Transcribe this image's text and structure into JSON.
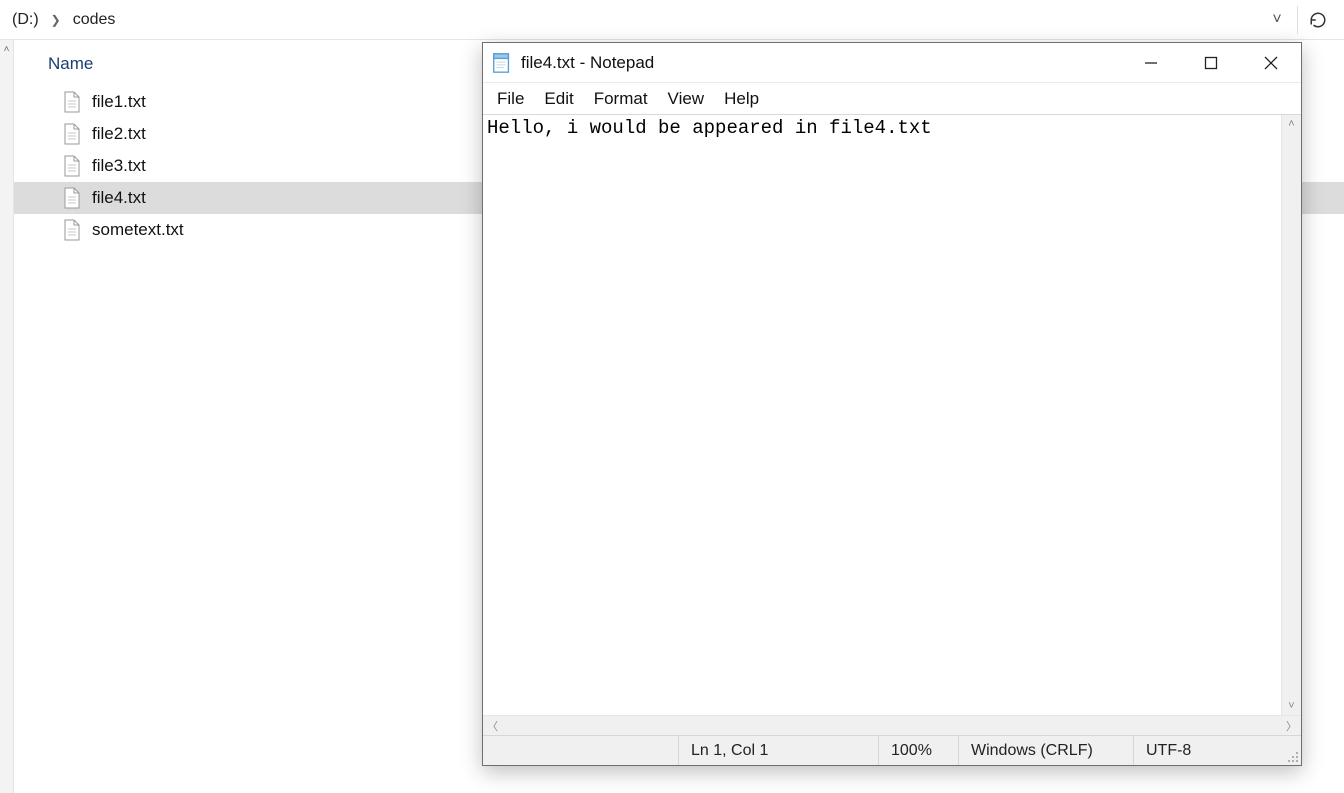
{
  "explorer": {
    "breadcrumb": {
      "drive": "(D:)",
      "folder": "codes"
    },
    "column_header": "Name",
    "files": [
      {
        "name": "file1.txt",
        "selected": false
      },
      {
        "name": "file2.txt",
        "selected": false
      },
      {
        "name": "file3.txt",
        "selected": false
      },
      {
        "name": "file4.txt",
        "selected": true
      },
      {
        "name": "sometext.txt",
        "selected": false
      }
    ]
  },
  "notepad": {
    "title": "file4.txt - Notepad",
    "menu": {
      "file": "File",
      "edit": "Edit",
      "format": "Format",
      "view": "View",
      "help": "Help"
    },
    "content": "Hello, i would be appeared in file4.txt",
    "status": {
      "position": "Ln 1, Col 1",
      "zoom": "100%",
      "line_ending": "Windows (CRLF)",
      "encoding": "UTF-8"
    }
  }
}
